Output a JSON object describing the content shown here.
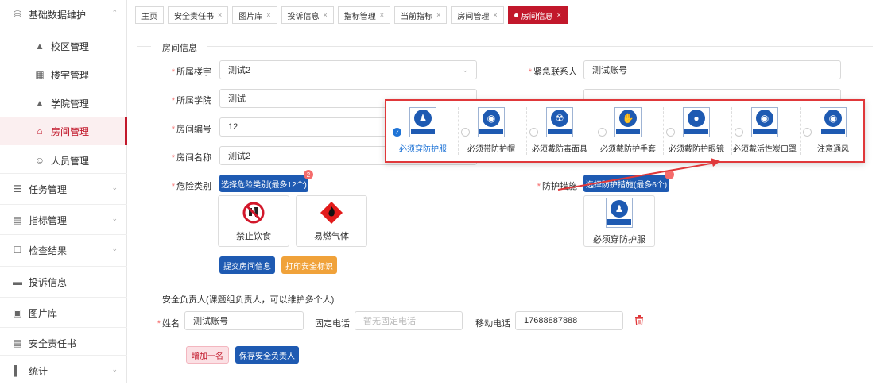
{
  "sidebar": {
    "items": [
      {
        "label": "基础数据维护",
        "icon": "database-icon",
        "expandable": true
      },
      {
        "label": "校区管理",
        "icon": "campus-icon"
      },
      {
        "label": "楼宇管理",
        "icon": "building-icon"
      },
      {
        "label": "学院管理",
        "icon": "graduation-cap-icon"
      },
      {
        "label": "房间管理",
        "icon": "home-icon"
      },
      {
        "label": "人员管理",
        "icon": "users-icon"
      },
      {
        "label": "任务管理",
        "icon": "layers-icon",
        "expandable": true
      },
      {
        "label": "指标管理",
        "icon": "book-icon",
        "expandable": true
      },
      {
        "label": "检查结果",
        "icon": "check-doc-icon",
        "expandable": true
      },
      {
        "label": "投诉信息",
        "icon": "complaint-icon"
      },
      {
        "label": "图片库",
        "icon": "image-icon"
      },
      {
        "label": "安全责任书",
        "icon": "document-icon"
      },
      {
        "label": "统计",
        "icon": "bar-chart-icon",
        "expandable": true
      }
    ]
  },
  "tabs": [
    {
      "label": "主页",
      "closable": false
    },
    {
      "label": "安全责任书",
      "closable": true
    },
    {
      "label": "图片库",
      "closable": true
    },
    {
      "label": "投诉信息",
      "closable": true
    },
    {
      "label": "指标管理",
      "closable": true
    },
    {
      "label": "当前指标",
      "closable": true
    },
    {
      "label": "房间管理",
      "closable": true
    },
    {
      "label": "房间信息",
      "closable": true,
      "active": true
    }
  ],
  "tab_close": "×",
  "room_section": {
    "title": "房间信息",
    "fields": {
      "building": {
        "label": "所属楼宇",
        "value": "测试2"
      },
      "college": {
        "label": "所属学院",
        "value": "测试"
      },
      "room_no": {
        "label": "房间编号",
        "value": "12"
      },
      "room_name": {
        "label": "房间名称",
        "value": "测试2"
      },
      "emergency": {
        "label": "紧急联系人",
        "value": "测试账号"
      }
    },
    "danger": {
      "label": "危险类别",
      "button": "选择危险类别(最多12个)",
      "badge": "2",
      "items": [
        {
          "caption": "禁止饮食",
          "icon": "no-eating-icon"
        },
        {
          "caption": "易燃气体",
          "icon": "flammable-gas-icon"
        }
      ]
    },
    "protect": {
      "label": "防护措施",
      "button": "选择防护措施(最多6个)",
      "items": [
        {
          "caption": "必须穿防护服",
          "icon": "protective-suit-icon"
        }
      ]
    },
    "submit_button": "提交房间信息",
    "print_button": "打印安全标识"
  },
  "protection_options": [
    {
      "caption": "必须穿防护服",
      "icon": "protective-suit-icon",
      "checked": true
    },
    {
      "caption": "必须带防护帽",
      "icon": "helmet-icon",
      "checked": false
    },
    {
      "caption": "必须戴防毒面具",
      "icon": "gas-mask-icon",
      "checked": false
    },
    {
      "caption": "必须戴防护手套",
      "icon": "gloves-icon",
      "checked": false
    },
    {
      "caption": "必须戴防护眼镜",
      "icon": "goggles-icon",
      "checked": false
    },
    {
      "caption": "必须戴活性炭口罩",
      "icon": "mask-icon",
      "checked": false
    },
    {
      "caption": "注意通风",
      "icon": "ventilation-icon",
      "checked": false
    }
  ],
  "safety_section": {
    "title": "安全负责人(课题组负责人，可以维护多个人)",
    "name_label": "姓名",
    "name_value": "测试账号",
    "phone_label": "固定电话",
    "phone_placeholder": "暂无固定电话",
    "mobile_label": "移动电话",
    "mobile_value": "17688887888",
    "add_button": "增加一名",
    "save_button": "保存安全负责人"
  },
  "colors": {
    "accent": "#c2182b",
    "primary": "#1e5ab2",
    "warning": "#f0a23a",
    "highlight": "#e0383a"
  }
}
